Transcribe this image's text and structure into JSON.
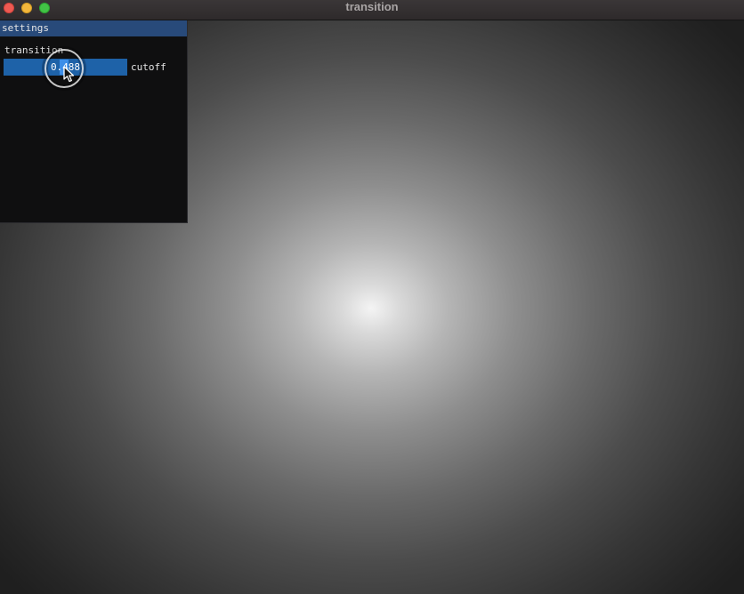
{
  "window": {
    "title": "transition",
    "controls": [
      "close-icon",
      "minimize-icon",
      "zoom-icon"
    ],
    "colors": {
      "close": "#ee5a52",
      "minimize": "#f3b73c",
      "zoom": "#42c346"
    }
  },
  "panel": {
    "title": "settings",
    "header_color": "#284a7a",
    "group_label": "transition",
    "slider": {
      "value_text": "0.488",
      "value": 0.488,
      "min": 0,
      "max": 1,
      "label": "cutoff",
      "fill_color": "#1e62a8",
      "grab_color": "#3d8ee8"
    }
  },
  "viewport": {
    "content": "radial-gradient render",
    "center_color": "#f4f4f4",
    "edge_color": "#1f1f1f"
  },
  "cursor": {
    "icon": "arrow-cursor-icon"
  }
}
